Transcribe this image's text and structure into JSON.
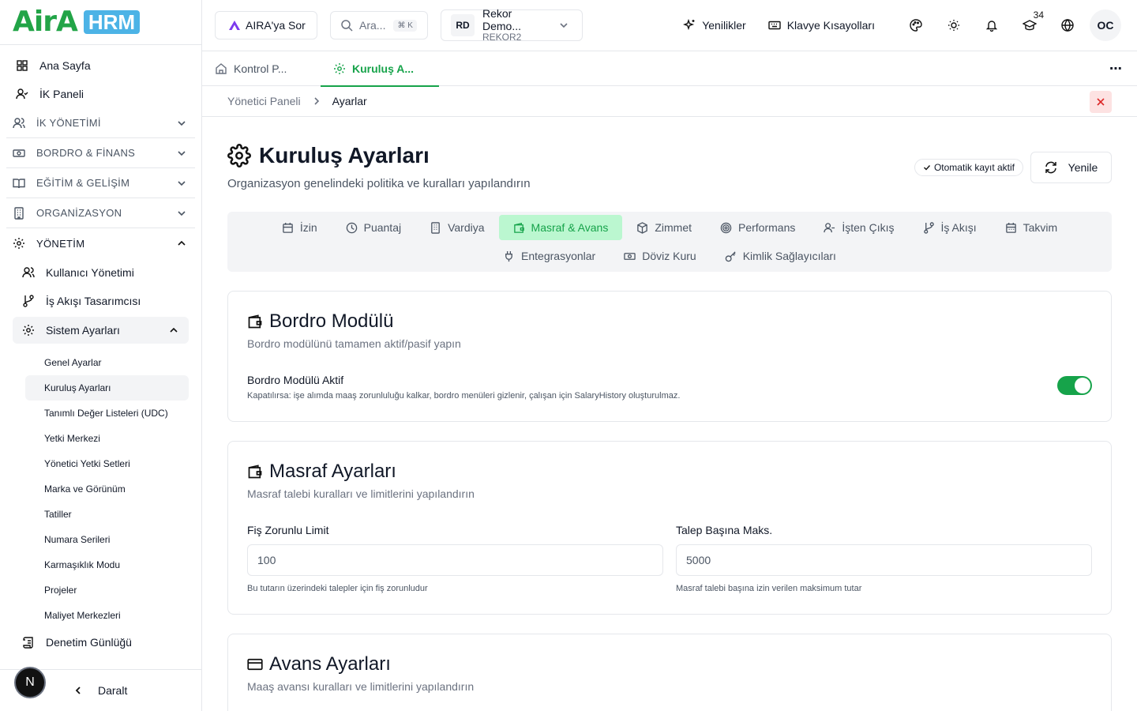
{
  "brand": {
    "name": "AirA",
    "product": "HRM",
    "primary": "#16a34a",
    "logo_blue": "#4cb3e6"
  },
  "sidebar": {
    "items": [
      {
        "label": "Ana Sayfa",
        "icon": "dashboard-icon"
      },
      {
        "label": "İK Paneli",
        "icon": "user-check-icon"
      }
    ],
    "sections": [
      {
        "label": "İK YÖNETİMİ",
        "icon": "users-icon"
      },
      {
        "label": "BORDRO & FİNANS",
        "icon": "banknote-icon"
      },
      {
        "label": "EĞİTİM & GELİŞİM",
        "icon": "book-icon"
      },
      {
        "label": "ORGANİZASYON",
        "icon": "building-icon"
      }
    ],
    "management": {
      "label": "YÖNETİM",
      "items": [
        {
          "label": "Kullanıcı Yönetimi"
        },
        {
          "label": "İş Akışı Tasarımcısı"
        }
      ],
      "system_settings": {
        "label": "Sistem Ayarları",
        "children": [
          "Genel Ayarlar",
          "Kuruluş Ayarları",
          "Tanımlı Değer Listeleri (UDC)",
          "Yetki Merkezi",
          "Yönetici Yetki Setleri",
          "Marka ve Görünüm",
          "Tatiller",
          "Numara Serileri",
          "Karmaşıklık Modu",
          "Projeler",
          "Maliyet Merkezleri"
        ]
      },
      "audit_log": "Denetim Günlüğü"
    },
    "avatar_letter": "N",
    "collapse_label": "Daralt"
  },
  "topbar": {
    "ask_label": "AIRA'ya Sor",
    "search_placeholder": "Ara...",
    "search_kbd": "⌘ K",
    "company_initials": "RD",
    "company_name": "Rekor Demo...",
    "company_code": "REKOR2",
    "news_label": "Yenilikler",
    "shortcuts_label": "Klavye Kısayolları",
    "notification_count": "34",
    "user_initials": "OC"
  },
  "page_tabs": [
    {
      "label": "Kontrol P..."
    },
    {
      "label": "Kuruluş A..."
    }
  ],
  "breadcrumb": {
    "parent": "Yönetici Paneli",
    "current": "Ayarlar"
  },
  "page": {
    "title": "Kuruluş Ayarları",
    "subtitle": "Organizasyon genelindeki politika ve kuralları yapılandırın",
    "autosave_label": "Otomatik kayıt aktif",
    "refresh_label": "Yenile"
  },
  "settings_tabs": {
    "row1": [
      "İzin",
      "Puantaj",
      "Vardiya",
      "Masraf & Avans",
      "Zimmet",
      "Performans",
      "İşten Çıkış",
      "İş Akışı",
      "Takvim"
    ],
    "row2": [
      "Entegrasyonlar",
      "Döviz Kuru",
      "Kimlik Sağlayıcıları"
    ],
    "active": "Masraf & Avans"
  },
  "payroll_card": {
    "title": "Bordro Modülü",
    "description": "Bordro modülünü tamamen aktif/pasif yapın",
    "toggle_label": "Bordro Modülü Aktif",
    "toggle_hint": "Kapatılırsa: işe alımda maaş zorunluluğu kalkar, bordro menüleri gizlenir, çalışan için SalaryHistory oluşturulmaz.",
    "toggle_on": true
  },
  "expense_card": {
    "title": "Masraf Ayarları",
    "description": "Masraf talebi kuralları ve limitlerini yapılandırın",
    "fields": [
      {
        "label": "Fiş Zorunlu Limit",
        "value": "100",
        "hint": "Bu tutarın üzerindeki talepler için fiş zorunludur"
      },
      {
        "label": "Talep Başına Maks.",
        "value": "5000",
        "hint": "Masraf talebi başına izin verilen maksimum tutar"
      }
    ]
  },
  "advance_card": {
    "title": "Avans Ayarları",
    "description": "Maaş avansı kuralları ve limitlerini yapılandırın"
  }
}
